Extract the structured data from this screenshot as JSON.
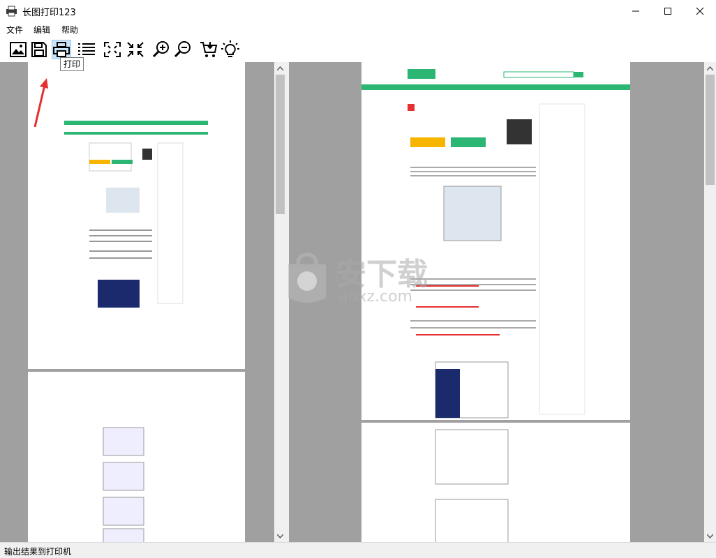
{
  "window": {
    "title": "长图打印123"
  },
  "menu": {
    "items": [
      "文件",
      "编辑",
      "帮助"
    ]
  },
  "toolbar": {
    "buttons": [
      {
        "name": "open-image-icon"
      },
      {
        "name": "save-icon"
      },
      {
        "name": "print-icon"
      },
      {
        "name": "page-list-icon"
      },
      {
        "name": "fit-page-icon"
      },
      {
        "name": "actual-size-icon"
      },
      {
        "name": "zoom-in-icon"
      },
      {
        "name": "zoom-out-icon"
      },
      {
        "name": "purchase-cart-icon"
      },
      {
        "name": "tips-bulb-icon"
      }
    ],
    "tooltip": "打印"
  },
  "watermark": {
    "name": "安下载",
    "url": "anxz.com"
  },
  "status": {
    "text": "输出结果到打印机"
  },
  "colors": {
    "accent_green": "#2bb673",
    "arrow_red": "#e53030",
    "pane_bg": "#a0a0a0"
  }
}
